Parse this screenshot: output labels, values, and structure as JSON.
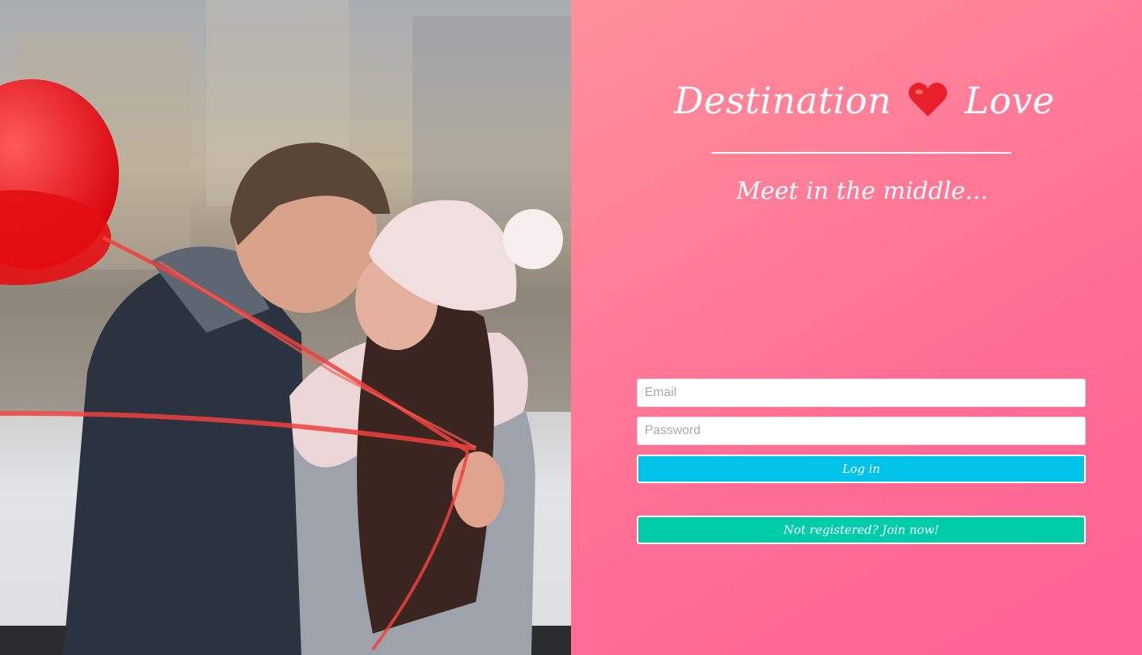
{
  "brand": {
    "name_part1": "Destination",
    "heart_icon": "heart-icon",
    "name_part2": "Love"
  },
  "tagline": "Meet in the middle...",
  "login_form": {
    "email_placeholder": "Email",
    "email_value": "",
    "password_placeholder": "Password",
    "password_value": "",
    "login_label": "Log in",
    "join_label": "Not registered? Join now!"
  },
  "colors": {
    "panel_gradient_start": "#ff8f9c",
    "panel_gradient_end": "#ff6294",
    "login_button": "#00c3ea",
    "join_button": "#00cca9",
    "heart": "#e8202a"
  }
}
